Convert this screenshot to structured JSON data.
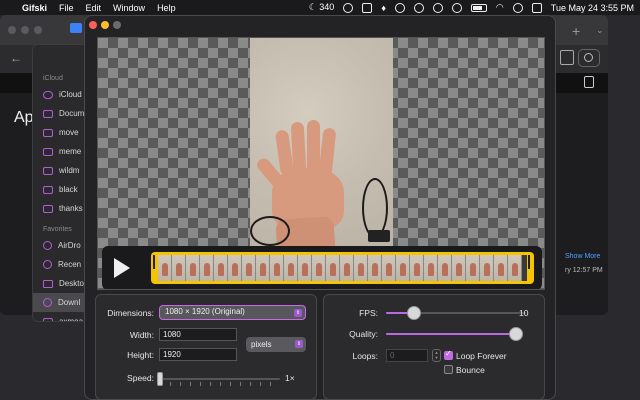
{
  "menubar": {
    "app": "Gifski",
    "items": [
      "File",
      "Edit",
      "Window",
      "Help"
    ],
    "status_count": "340",
    "date_time": "Tue May 24  3:55 PM"
  },
  "browser": {
    "heading": "Ap",
    "show_more": "Show More",
    "time": "ry 12:57 PM"
  },
  "finder": {
    "section_icloud": "iCloud",
    "icloud_items": [
      "iCloud",
      "Docum",
      "move",
      "meme",
      "wildm",
      "black",
      "thanks"
    ],
    "section_favorites": "Favorites",
    "favorite_items": [
      "AirDro",
      "Recen",
      "Deskto",
      "Downl",
      "axmea"
    ]
  },
  "gifski": {
    "dimensions_label": "Dimensions:",
    "dimensions_value": "1080 × 1920 (Original)",
    "width_label": "Width:",
    "width_value": "1080",
    "height_label": "Height:",
    "height_value": "1920",
    "unit_value": "pixels",
    "speed_label": "Speed:",
    "speed_value": "1×",
    "speed_level": 0.0,
    "fps_label": "FPS:",
    "fps_value": "10",
    "fps_level": 0.2,
    "quality_label": "Quality:",
    "quality_level": 1.0,
    "loops_label": "Loops:",
    "loops_value": "0",
    "loop_forever_label": "Loop Forever",
    "loop_forever_checked": true,
    "bounce_label": "Bounce",
    "bounce_checked": false
  },
  "colors": {
    "accent": "#c06ae6",
    "trim": "#f5c400"
  }
}
